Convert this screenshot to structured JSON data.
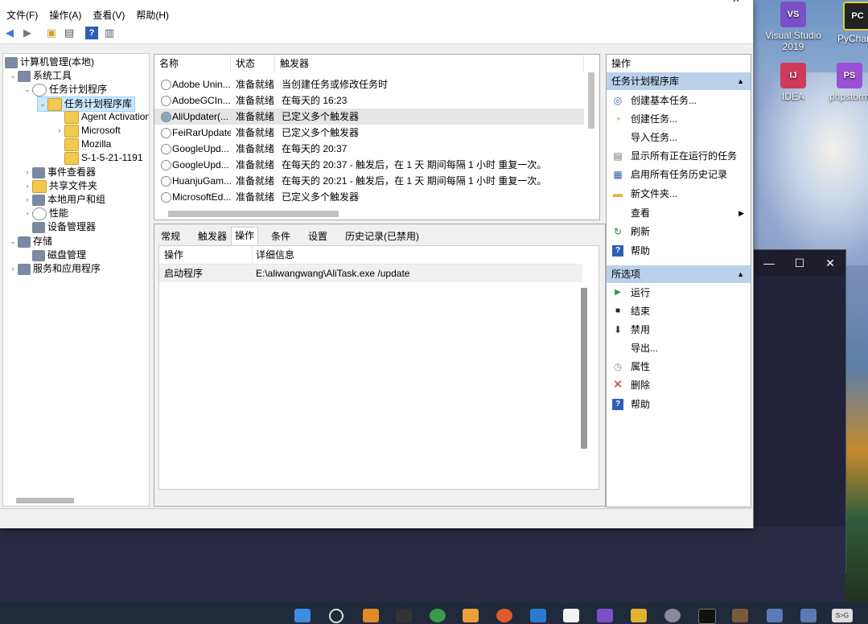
{
  "desktop": {
    "icons": [
      {
        "label": "Visual Studio 2019",
        "badge": "VS",
        "color": "#7b4fc8"
      },
      {
        "label": "PyCharm",
        "badge": "PC",
        "color": "#222222"
      },
      {
        "label": "IDEA",
        "badge": "IJ",
        "color": "#d23a5a"
      },
      {
        "label": "phpstorm",
        "badge": "PS",
        "color": "#9b4fd2"
      }
    ]
  },
  "window": {
    "title_glyph": "—",
    "close_glyph": "✕",
    "menu": [
      "文件(F)",
      "操作(A)",
      "查看(V)",
      "帮助(H)"
    ]
  },
  "tree": {
    "items": [
      {
        "label": "计算机管理(本地)"
      },
      {
        "label": "系统工具"
      },
      {
        "label": "任务计划程序"
      },
      {
        "label": "任务计划程序库"
      },
      {
        "label": "Agent Activation"
      },
      {
        "label": "Microsoft"
      },
      {
        "label": "Mozilla"
      },
      {
        "label": "S-1-5-21-1191"
      },
      {
        "label": "事件查看器"
      },
      {
        "label": "共享文件夹"
      },
      {
        "label": "本地用户和组"
      },
      {
        "label": "性能"
      },
      {
        "label": "设备管理器"
      },
      {
        "label": "存储"
      },
      {
        "label": "磁盘管理"
      },
      {
        "label": "服务和应用程序"
      }
    ]
  },
  "tasks": {
    "columns": [
      "名称",
      "状态",
      "触发器"
    ],
    "rows": [
      {
        "name": "Adobe Unin...",
        "status": "准备就绪",
        "trigger": "当创建任务或修改任务时"
      },
      {
        "name": "AdobeGCIn...",
        "status": "准备就绪",
        "trigger": "在每天的 16:23"
      },
      {
        "name": "AliUpdater(...",
        "status": "准备就绪",
        "trigger": "已定义多个触发器"
      },
      {
        "name": "FeiRarUpdate",
        "status": "准备就绪",
        "trigger": "已定义多个触发器"
      },
      {
        "name": "GoogleUpd...",
        "status": "准备就绪",
        "trigger": "在每天的 20:37"
      },
      {
        "name": "GoogleUpd...",
        "status": "准备就绪",
        "trigger": "在每天的 20:37 - 触发后，在 1 天 期间每隔 1 小时 重复一次。"
      },
      {
        "name": "HuanjuGam...",
        "status": "准备就绪",
        "trigger": "在每天的 20:21 - 触发后，在 1 天 期间每隔 1 小时 重复一次。"
      },
      {
        "name": "MicrosoftEd...",
        "status": "准备就绪",
        "trigger": "已定义多个触发器"
      }
    ]
  },
  "detail": {
    "tabs": [
      "常规",
      "触发器",
      "操作",
      "条件",
      "设置",
      "历史记录(已禁用)"
    ],
    "columns": [
      "操作",
      "详细信息"
    ],
    "row": {
      "action": "启动程序",
      "details": "E:\\aliwangwang\\AliTask.exe /update"
    }
  },
  "actions": {
    "header": "操作",
    "section1": "任务计划程序库",
    "items1": [
      {
        "label": "创建基本任务...",
        "icon": "wand-icon"
      },
      {
        "label": "创建任务...",
        "icon": "task-icon"
      },
      {
        "label": "导入任务...",
        "icon": "blank"
      },
      {
        "label": "显示所有正在运行的任务",
        "icon": "list-icon"
      },
      {
        "label": "启用所有任务历史记录",
        "icon": "history-icon"
      },
      {
        "label": "新文件夹...",
        "icon": "folder-icon"
      },
      {
        "label": "查看",
        "icon": "blank"
      },
      {
        "label": "刷新",
        "icon": "refresh-icon"
      },
      {
        "label": "帮助",
        "icon": "help-icon"
      }
    ],
    "section2": "所选项",
    "items2": [
      {
        "label": "运行",
        "icon": "play-icon"
      },
      {
        "label": "结束",
        "icon": "stop-icon"
      },
      {
        "label": "禁用",
        "icon": "disable-icon"
      },
      {
        "label": "导出...",
        "icon": "blank"
      },
      {
        "label": "属性",
        "icon": "properties-icon"
      },
      {
        "label": "删除",
        "icon": "delete-icon"
      },
      {
        "label": "帮助",
        "icon": "help-icon"
      }
    ]
  },
  "win2": {
    "minimize": "—",
    "maximize": "☐",
    "close": "✕"
  },
  "taskbar": {
    "tray_label": "S>G"
  },
  "colors": {
    "selection": "#cce8ff",
    "section_bg": "#b9d1ea",
    "highlight_row": "#e5e5e5"
  }
}
